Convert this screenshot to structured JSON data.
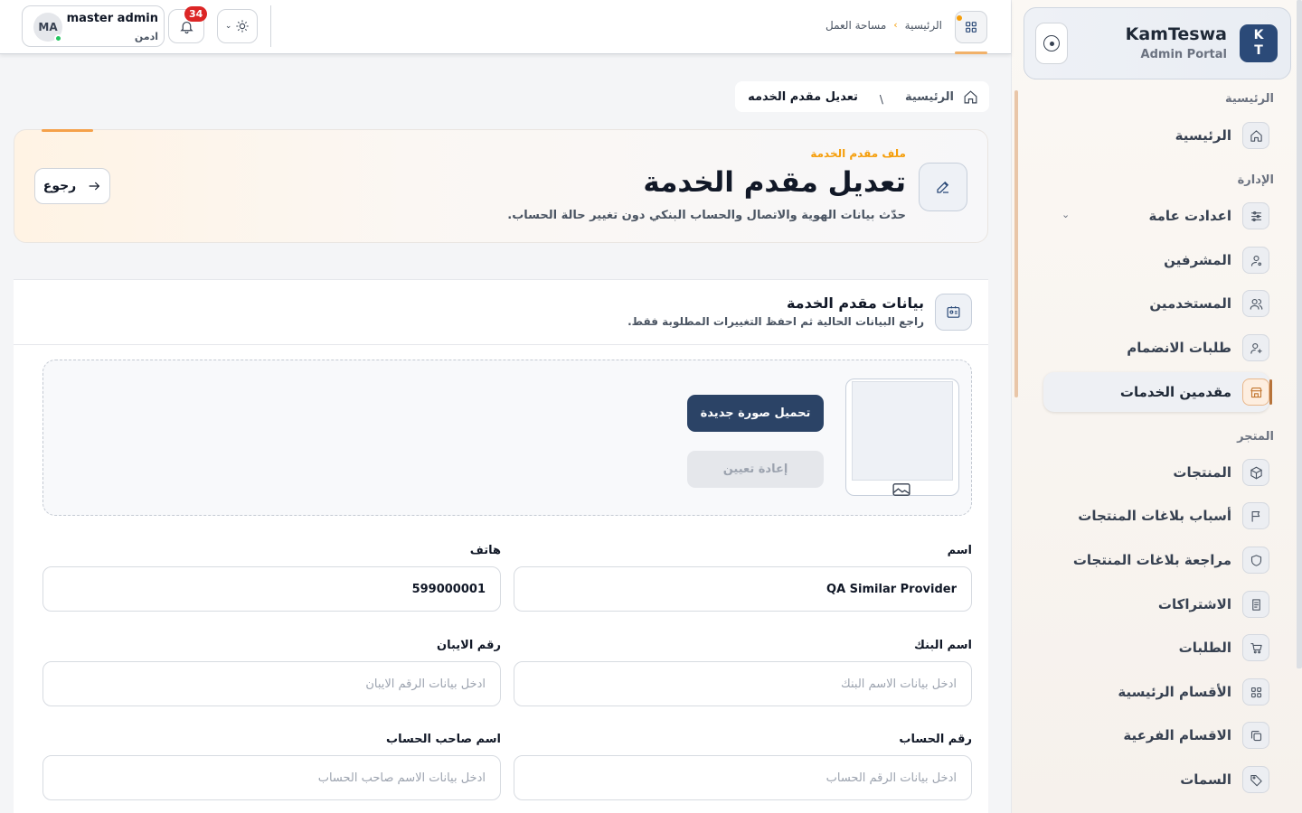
{
  "sidebar": {
    "brand": {
      "logo_top": "K",
      "logo_bottom": "T",
      "name": "KamTeswa",
      "sub": "Admin Portal"
    },
    "sections": {
      "home": "الرئيسية",
      "admin": "الإدارة",
      "store": "المتجر"
    },
    "items": {
      "home": "الرئيسية",
      "settings": "اعدادت عامة",
      "supervisors": "المشرفين",
      "users": "المستخدمين",
      "join_requests": "طلبات الانضمام",
      "providers": "مقدمين الخدمات",
      "products": "المنتجات",
      "report_reasons": "أسباب بلاغات المنتجات",
      "report_review": "مراجعة بلاغات المنتجات",
      "subscriptions": "الاشتراكات",
      "orders": "الطلبات",
      "main_categories": "الأقسام الرئيسية",
      "sub_categories": "الاقسام الفرعية",
      "attributes": "السمات"
    },
    "active": "providers"
  },
  "topbar": {
    "user": {
      "initials": "MA",
      "name": "master admin",
      "role": "ادمن"
    },
    "notifications_count": "34",
    "breadcrumb": {
      "home": "الرئيسية",
      "current": "مساحة العمل"
    }
  },
  "breadcrumb": {
    "home": "الرئيسية",
    "separator": "\\",
    "current": "تعديل مقدم الخدمه"
  },
  "hero": {
    "eyebrow": "ملف مقدم الخدمة",
    "title": "تعديل مقدم الخدمة",
    "description": "حدّث بيانات الهوية والاتصال والحساب البنكي دون تغيير حالة الحساب.",
    "back_label": "رجوع"
  },
  "form": {
    "title": "بيانات مقدم الخدمة",
    "subtitle": "راجع البيانات الحالية ثم احفظ التغييرات المطلوبة فقط.",
    "upload_label": "تحميل صورة جديدة",
    "reset_label": "إعادة تعيين",
    "fields": {
      "name": {
        "label": "اسم",
        "value": "QA Similar Provider",
        "placeholder": ""
      },
      "phone": {
        "label": "هاتف",
        "value": "599000001",
        "placeholder": ""
      },
      "bank_name": {
        "label": "اسم البنك",
        "value": "",
        "placeholder": "ادخل بيانات الاسم البنك"
      },
      "iban": {
        "label": "رقم الايبان",
        "value": "",
        "placeholder": "ادخل بيانات الرقم الايبان"
      },
      "account_number": {
        "label": "رقم الحساب",
        "value": "",
        "placeholder": "ادخل بيانات الرقم الحساب"
      },
      "account_holder": {
        "label": "اسم صاحب الحساب",
        "value": "",
        "placeholder": "ادخل بيانات الاسم صاحب الحساب"
      }
    }
  },
  "colors": {
    "primary": "#2b4366",
    "accent": "#f59e0b",
    "badge": "#dc2626",
    "online": "#22c55e"
  }
}
